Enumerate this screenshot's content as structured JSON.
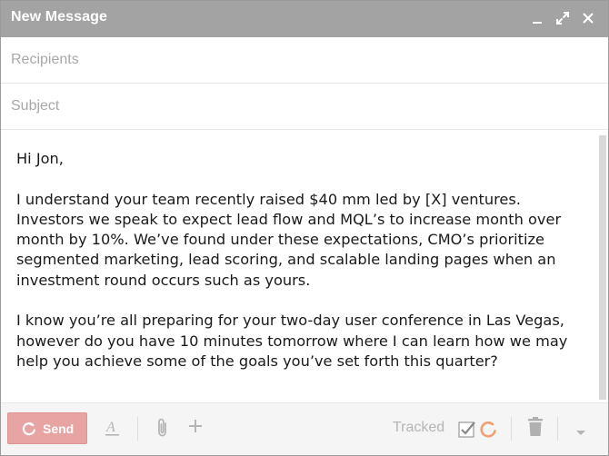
{
  "window": {
    "title": "New Message",
    "controls": [
      "minimize-icon",
      "expand-icon",
      "close-icon"
    ]
  },
  "fields": {
    "recipients_placeholder": "Recipients",
    "subject_placeholder": "Subject"
  },
  "body": {
    "greeting": "Hi Jon,",
    "paragraph1": "I understand your team recently raised $40 mm led by [X] ventures. Investors we speak to expect lead flow and MQL’s to increase month over month by 10%. We’ve found under these expectations, CMO’s prioritize segmented marketing, lead scoring, and scalable landing pages when an investment round occurs such as yours.",
    "paragraph2": "I know you’re all preparing for your two-day user conference in Las Vegas, however do you have 10 minutes tomorrow where I can learn how we may help you achieve some of the goals you’ve set forth this quarter?"
  },
  "toolbar": {
    "send_label": "Send",
    "tracked_label": "Tracked",
    "icons": [
      "send-icon",
      "formatting-icon",
      "attachment-icon",
      "plus-icon",
      "tracked-checkbox-icon",
      "tracking-logo-icon",
      "trash-icon",
      "more-options-icon"
    ]
  },
  "colors": {
    "titlebar": "#a3a3a3",
    "send_button": "#e8a3a3",
    "tracking_accent": "#f0a070"
  }
}
